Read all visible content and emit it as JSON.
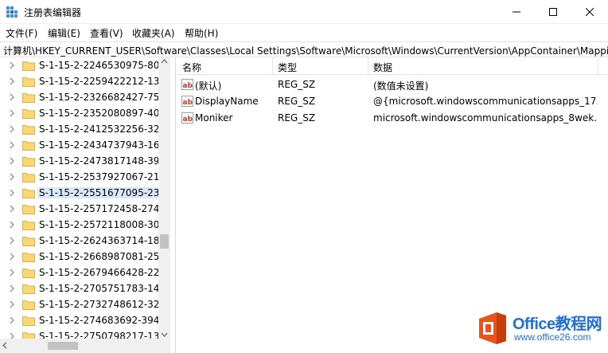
{
  "window": {
    "title": "注册表编辑器",
    "controls": {
      "minimize": "minimize-icon",
      "maximize": "maximize-icon",
      "close": "close-icon"
    }
  },
  "menu": [
    {
      "label": "文件(F)"
    },
    {
      "label": "编辑(E)"
    },
    {
      "label": "查看(V)"
    },
    {
      "label": "收藏夹(A)"
    },
    {
      "label": "帮助(H)"
    }
  ],
  "address": {
    "path": "计算机\\HKEY_CURRENT_USER\\Software\\Classes\\Local Settings\\Software\\Microsoft\\Windows\\CurrentVersion\\AppContainer\\Mappi"
  },
  "tree": {
    "items": [
      {
        "label": "S-1-15-2-2246530975-808"
      },
      {
        "label": "S-1-15-2-2259422212-133"
      },
      {
        "label": "S-1-15-2-2326682427-755"
      },
      {
        "label": "S-1-15-2-2352080897-405"
      },
      {
        "label": "S-1-15-2-2412532256-328"
      },
      {
        "label": "S-1-15-2-2434737943-167"
      },
      {
        "label": "S-1-15-2-2473817148-393"
      },
      {
        "label": "S-1-15-2-2537927067-214"
      },
      {
        "label": "S-1-15-2-2551677095-235",
        "selected": true
      },
      {
        "label": "S-1-15-2-257172458-2742"
      },
      {
        "label": "S-1-15-2-2572118008-307"
      },
      {
        "label": "S-1-15-2-2624363714-184"
      },
      {
        "label": "S-1-15-2-2668987081-256"
      },
      {
        "label": "S-1-15-2-2679466428-225"
      },
      {
        "label": "S-1-15-2-2705751783-149"
      },
      {
        "label": "S-1-15-2-2732748612-328"
      },
      {
        "label": "S-1-15-2-274683692-3946"
      },
      {
        "label": "S-1-15-2-2750798217-134"
      }
    ]
  },
  "values_list": {
    "columns": {
      "name": "名称",
      "type": "类型",
      "data": "数据"
    },
    "rows": [
      {
        "name": "(默认)",
        "type": "REG_SZ",
        "data": "(数值未设置)"
      },
      {
        "name": "DisplayName",
        "type": "REG_SZ",
        "data": "@{microsoft.windowscommunicationsapps_17..."
      },
      {
        "name": "Moniker",
        "type": "REG_SZ",
        "data": "microsoft.windowscommunicationsapps_8wek..."
      }
    ]
  },
  "watermark": {
    "brand": "Office教程网",
    "url": "www.office26.com",
    "colors": {
      "orange": "#e8541c",
      "blue": "#1f6fd6"
    }
  }
}
